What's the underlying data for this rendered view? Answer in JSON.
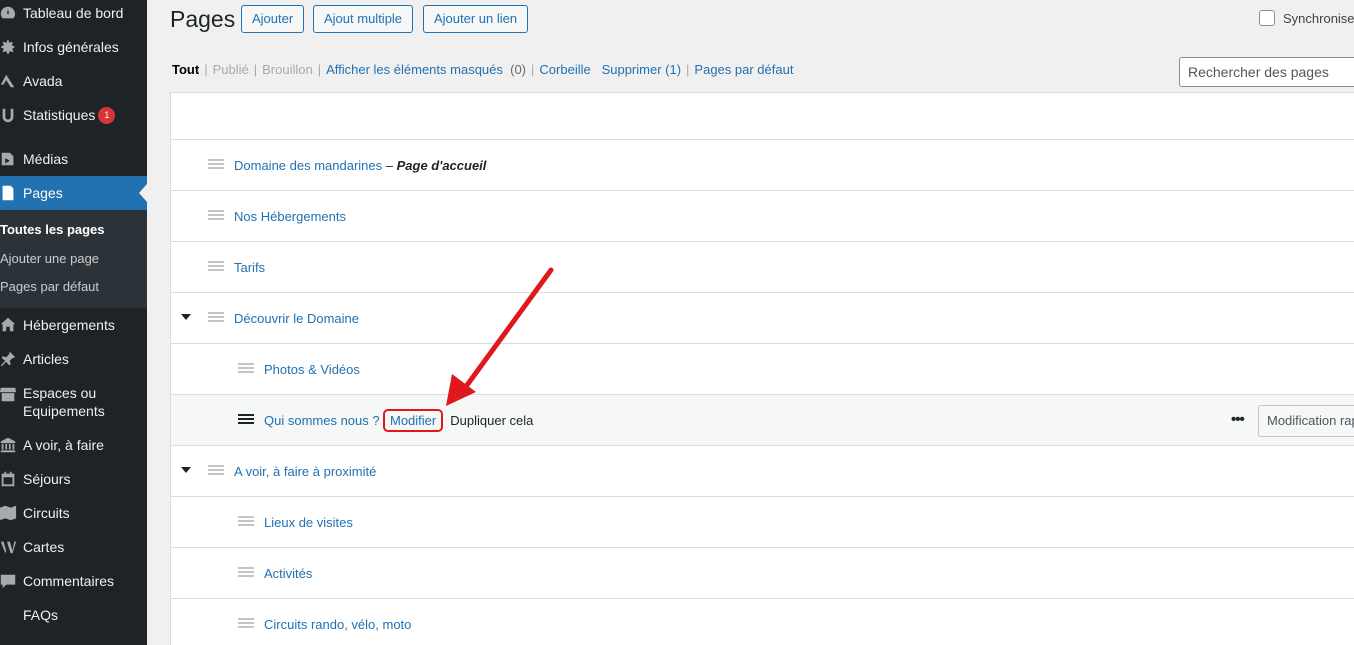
{
  "sidebar": {
    "items": [
      {
        "name": "tableau-de-bord",
        "label": "Tableau de bord",
        "icon": "dashboard-icon"
      },
      {
        "name": "infos-generales",
        "label": "Infos générales",
        "icon": "gear-icon"
      },
      {
        "name": "avada",
        "label": "Avada",
        "icon": "avada-icon"
      },
      {
        "name": "statistiques",
        "label": "Statistiques",
        "icon": "stats-icon",
        "badge": "1"
      },
      {
        "name": "medias",
        "label": "Médias",
        "icon": "media-icon"
      },
      {
        "name": "pages",
        "label": "Pages",
        "icon": "page-icon"
      },
      {
        "name": "hebergements",
        "label": "Hébergements",
        "icon": "home-icon"
      },
      {
        "name": "articles",
        "label": "Articles",
        "icon": "pin-icon"
      },
      {
        "name": "espaces",
        "label": "Espaces ou Equipements",
        "icon": "store-icon"
      },
      {
        "name": "a-voir",
        "label": "A voir, à faire",
        "icon": "bank-icon"
      },
      {
        "name": "sejours",
        "label": "Séjours",
        "icon": "calendar-icon"
      },
      {
        "name": "circuits",
        "label": "Circuits",
        "icon": "map-icon"
      },
      {
        "name": "cartes",
        "label": "Cartes",
        "icon": "wordpress-icon"
      },
      {
        "name": "commentaires",
        "label": "Commentaires",
        "icon": "comment-icon"
      },
      {
        "name": "faqs",
        "label": "FAQs",
        "icon": "faq-icon"
      }
    ],
    "submenu": [
      "Toutes les pages",
      "Ajouter une page",
      "Pages par défaut"
    ]
  },
  "header": {
    "title": "Pages",
    "buttons": [
      "Ajouter",
      "Ajout multiple",
      "Ajouter un lien"
    ],
    "sync_label": "Synchroniser"
  },
  "filters": {
    "tout": "Tout",
    "publie": "Publié",
    "brouillon": "Brouillon",
    "masques": "Afficher les éléments masqués",
    "masques_count": "(0)",
    "corbeille": "Corbeille",
    "supprimer": "Supprimer (1)",
    "defaut": "Pages par défaut"
  },
  "search": {
    "placeholder": "Rechercher des pages"
  },
  "rows": [
    {
      "title": "Domaine des mandarines",
      "dash": " – ",
      "state": "Page d'accueil"
    },
    {
      "title": "Nos Hébergements"
    },
    {
      "title": "Tarifs"
    },
    {
      "title": "Découvrir le Domaine"
    },
    {
      "title": "Photos & Vidéos"
    },
    {
      "title": "Qui sommes nous ?"
    },
    {
      "title": "A voir, à faire à proximité"
    },
    {
      "title": "Lieux de visites"
    },
    {
      "title": "Activités"
    },
    {
      "title": "Circuits rando, vélo, moto"
    }
  ],
  "row_actions": {
    "modifier": "Modifier",
    "dupliquer": "Dupliquer cela",
    "more": "•••",
    "quick": "Modification rapide"
  },
  "colors": {
    "accent": "#2271b1",
    "sidebar": "#1d2327",
    "highlight": "#e0181b"
  }
}
